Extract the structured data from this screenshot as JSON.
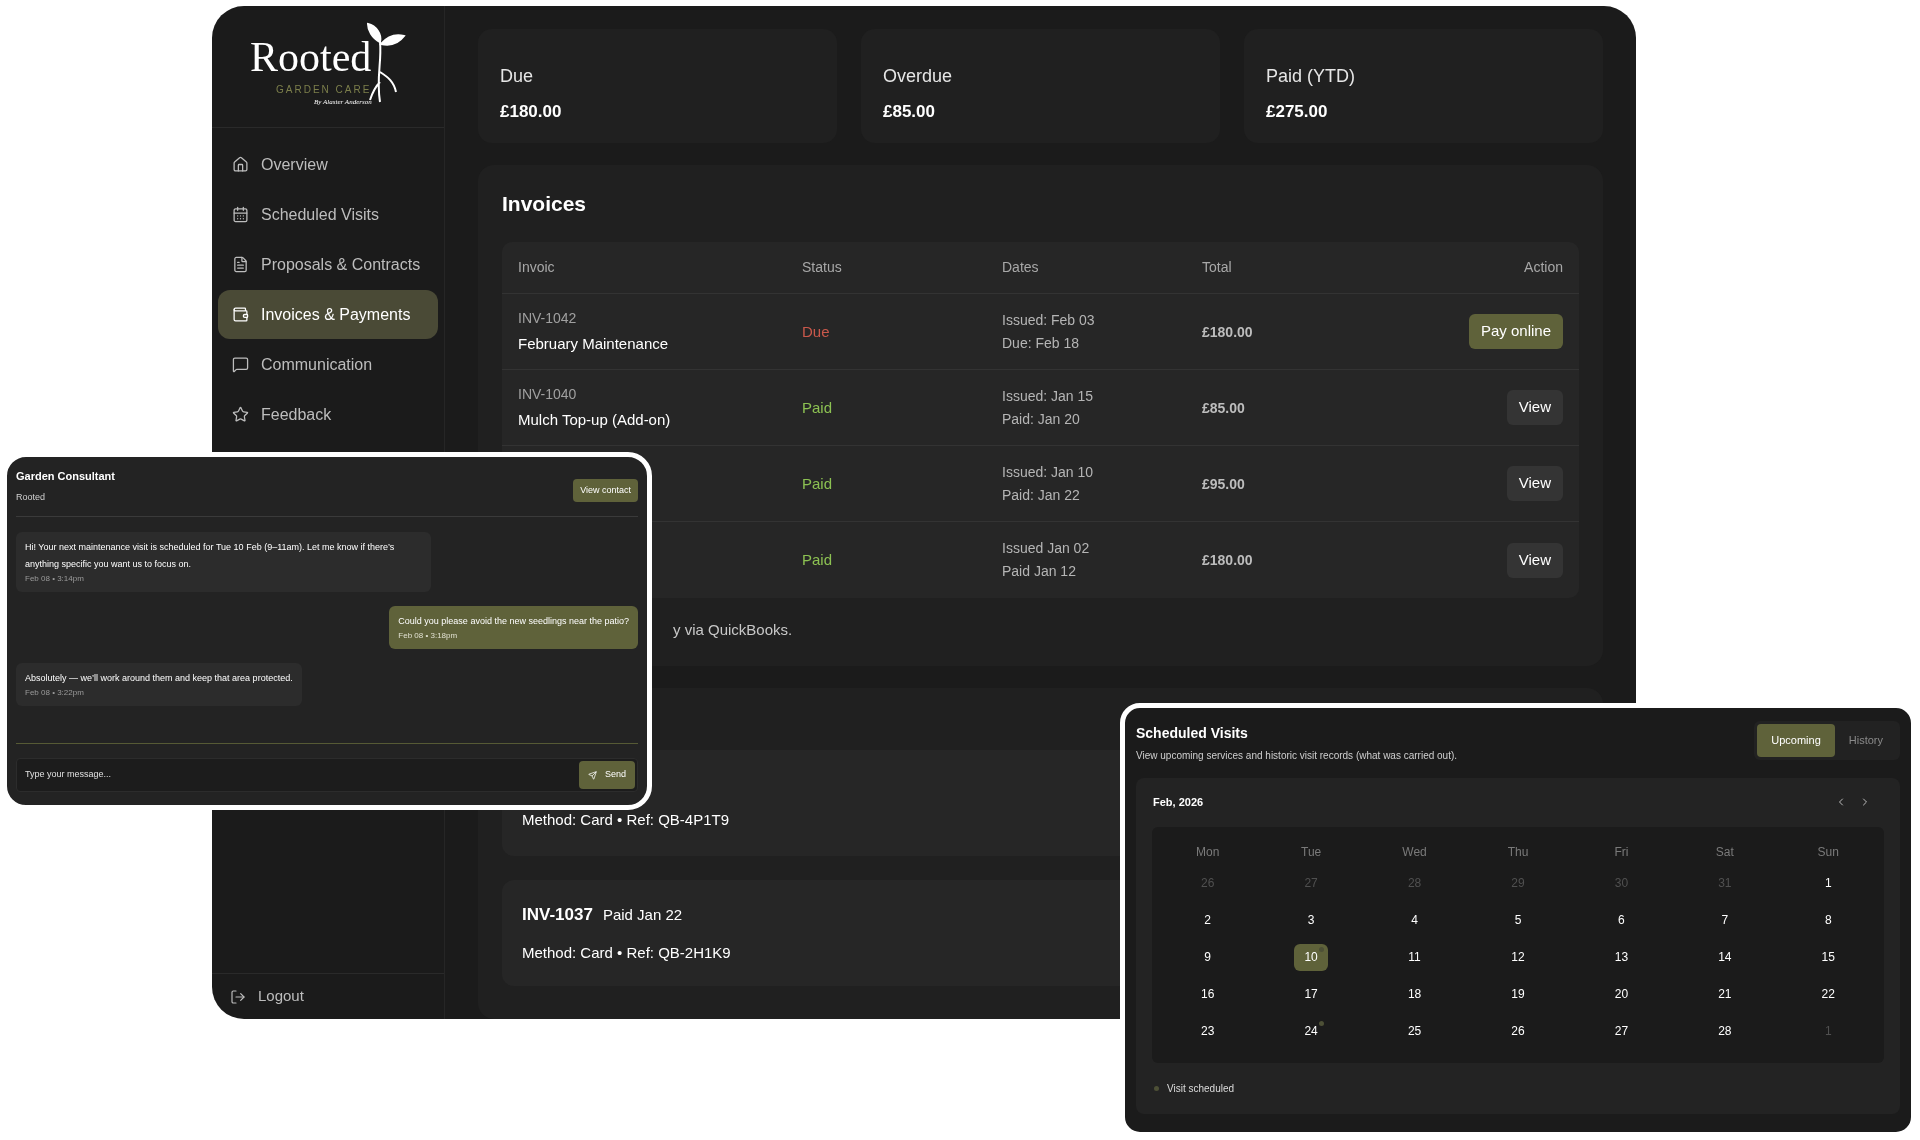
{
  "sidebar": {
    "logo": {
      "name": "Rooted",
      "tagline": "GARDEN CARE",
      "byline": "By Alaster Anderson"
    },
    "items": [
      {
        "label": "Overview",
        "kind": "home",
        "selected": false
      },
      {
        "label": "Scheduled Visits",
        "kind": "calendar",
        "selected": false
      },
      {
        "label": "Proposals & Contracts",
        "kind": "document",
        "selected": false
      },
      {
        "label": "Invoices & Payments",
        "kind": "wallet",
        "selected": true
      },
      {
        "label": "Communication",
        "kind": "message",
        "selected": false
      },
      {
        "label": "Feedback",
        "kind": "star",
        "selected": false
      }
    ],
    "logout": "Logout"
  },
  "stats": [
    {
      "label": "Due",
      "value": "£180.00"
    },
    {
      "label": "Overdue",
      "value": "£85.00"
    },
    {
      "label": "Paid (YTD)",
      "value": "£275.00"
    }
  ],
  "invoices": {
    "title": "Invoices",
    "columns": [
      "Invoic",
      "Status",
      "Dates",
      "Total",
      "Action"
    ],
    "rows": [
      {
        "id": "INV-1042",
        "title": "February Maintenance",
        "status": "Due",
        "kind": "due",
        "dates": [
          "Issued: Feb 03",
          "Due: Feb 18"
        ],
        "total": "£180.00",
        "action": {
          "label": "Pay online",
          "kind": "primary"
        }
      },
      {
        "id": "INV-1040",
        "title": "Mulch Top-up (Add-on)",
        "status": "Paid",
        "kind": "paid",
        "dates": [
          "Issued: Jan 15",
          "Paid: Jan 20"
        ],
        "total": "£85.00",
        "action": {
          "label": "View",
          "kind": "secondary"
        }
      },
      {
        "status": "Paid",
        "kind": "paid",
        "dates": [
          "Issued: Jan 10",
          "Paid: Jan 22"
        ],
        "total": "£95.00",
        "action": {
          "label": "View",
          "kind": "secondary"
        }
      },
      {
        "status": "Paid",
        "kind": "paid",
        "dates": [
          "Issued Jan 02",
          "Paid Jan 12"
        ],
        "total": "£180.00",
        "action": {
          "label": "View",
          "kind": "secondary"
        }
      }
    ],
    "note": "y via QuickBooks."
  },
  "payments": [
    {
      "method": "Method: Card • Ref: QB-4P1T9"
    },
    {
      "id": "INV-1037",
      "paid": "Paid Jan 22",
      "method": "Method: Card • Ref: QB-2H1K9"
    }
  ],
  "chat": {
    "title": "Garden Consultant",
    "subtitle": "Rooted",
    "contact_button": "View contact",
    "messages": [
      {
        "kind": "incoming",
        "text": "Hi! Your next maintenance visit is scheduled for Tue 10 Feb (9–11am). Let me know if there’s anything specific you want us to focus on.",
        "time": "Feb 08 • 3:14pm"
      },
      {
        "kind": "outgoing",
        "text": "Could you please avoid the new seedlings near the patio?",
        "time": "Feb 08 • 3:18pm"
      },
      {
        "kind": "incoming",
        "text": "Absolutely — we’ll work around them and keep that area protected.",
        "time": "Feb 08 • 3:22pm"
      }
    ],
    "input": {
      "placeholder": "Type your message..."
    },
    "send": "Send"
  },
  "visits": {
    "title": "Scheduled Visits",
    "subtitle": "View upcoming services and historic visit records (what was carried out).",
    "tabs": [
      {
        "label": "Upcoming",
        "selected": true
      },
      {
        "label": "History",
        "selected": false
      }
    ],
    "month": "Feb, 2026",
    "weekdays": [
      "Mon",
      "Tue",
      "Wed",
      "Thu",
      "Fri",
      "Sat",
      "Sun"
    ],
    "days": [
      {
        "label": "26",
        "muted": true,
        "selected": false,
        "visit": false
      },
      {
        "label": "27",
        "muted": true,
        "selected": false,
        "visit": false
      },
      {
        "label": "28",
        "muted": true,
        "selected": false,
        "visit": false
      },
      {
        "label": "29",
        "muted": true,
        "selected": false,
        "visit": false
      },
      {
        "label": "30",
        "muted": true,
        "selected": false,
        "visit": false
      },
      {
        "label": "31",
        "muted": true,
        "selected": false,
        "visit": false
      },
      {
        "label": "1",
        "muted": false,
        "selected": false,
        "visit": false
      },
      {
        "label": "2",
        "muted": false,
        "selected": false,
        "visit": false
      },
      {
        "label": "3",
        "muted": false,
        "selected": false,
        "visit": false
      },
      {
        "label": "4",
        "muted": false,
        "selected": false,
        "visit": false
      },
      {
        "label": "5",
        "muted": false,
        "selected": false,
        "visit": false
      },
      {
        "label": "6",
        "muted": false,
        "selected": false,
        "visit": false
      },
      {
        "label": "7",
        "muted": false,
        "selected": false,
        "visit": false
      },
      {
        "label": "8",
        "muted": false,
        "selected": false,
        "visit": false
      },
      {
        "label": "9",
        "muted": false,
        "selected": false,
        "visit": false
      },
      {
        "label": "10",
        "muted": false,
        "selected": true,
        "visit": true
      },
      {
        "label": "11",
        "muted": false,
        "selected": false,
        "visit": false
      },
      {
        "label": "12",
        "muted": false,
        "selected": false,
        "visit": false
      },
      {
        "label": "13",
        "muted": false,
        "selected": false,
        "visit": false
      },
      {
        "label": "14",
        "muted": false,
        "selected": false,
        "visit": false
      },
      {
        "label": "15",
        "muted": false,
        "selected": false,
        "visit": false
      },
      {
        "label": "16",
        "muted": false,
        "selected": false,
        "visit": false
      },
      {
        "label": "17",
        "muted": false,
        "selected": false,
        "visit": false
      },
      {
        "label": "18",
        "muted": false,
        "selected": false,
        "visit": false
      },
      {
        "label": "19",
        "muted": false,
        "selected": false,
        "visit": false
      },
      {
        "label": "20",
        "muted": false,
        "selected": false,
        "visit": false
      },
      {
        "label": "21",
        "muted": false,
        "selected": false,
        "visit": false
      },
      {
        "label": "22",
        "muted": false,
        "selected": false,
        "visit": false
      },
      {
        "label": "23",
        "muted": false,
        "selected": false,
        "visit": false
      },
      {
        "label": "24",
        "muted": false,
        "selected": false,
        "visit": true
      },
      {
        "label": "25",
        "muted": false,
        "selected": false,
        "visit": false
      },
      {
        "label": "26",
        "muted": false,
        "selected": false,
        "visit": false
      },
      {
        "label": "27",
        "muted": false,
        "selected": false,
        "visit": false
      },
      {
        "label": "28",
        "muted": false,
        "selected": false,
        "visit": false
      },
      {
        "label": "1",
        "muted": true,
        "selected": false,
        "visit": false
      }
    ],
    "legend": "Visit scheduled"
  }
}
